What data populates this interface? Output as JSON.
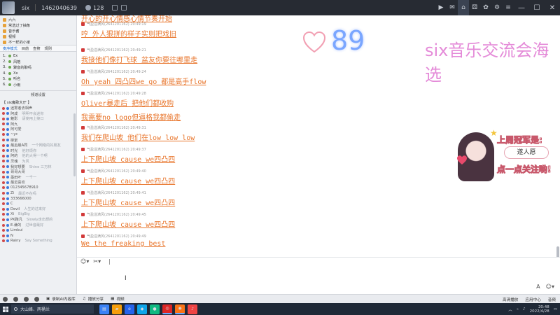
{
  "titlebar": {
    "username": "six",
    "user_id": "1462040639",
    "user_count": "128",
    "icons": [
      "video-icon",
      "message-icon",
      "home-icon",
      "game-icon",
      "gift-icon",
      "settings-icon",
      "menu-icon",
      "minimize-icon",
      "maximize-icon",
      "close-icon"
    ]
  },
  "sidebar": {
    "top_items": [
      "六六",
      "常选过了抽象",
      "音乐酱",
      "视频",
      "不一样的小家",
      "更多"
    ],
    "tabs": [
      "麦序模式",
      "目前",
      "查搜",
      "规则"
    ],
    "list_items": [
      {
        "rank": "1.",
        "label": "Ex"
      },
      {
        "rank": "2.",
        "label": "风格"
      },
      {
        "rank": "3.",
        "label": "聚音的聊吗"
      },
      {
        "rank": "4.",
        "label": "Xx"
      },
      {
        "rank": "5.",
        "label": "听名"
      },
      {
        "rank": "6.",
        "label": "小雨"
      },
      {
        "rank": "7.",
        "label": "歌手"
      }
    ],
    "channel_label": "频道设置",
    "channel_room": "【 six魔歌大厅 】",
    "members": [
      {
        "name": "迷雾者去相声",
        "sub": ""
      },
      {
        "name": "阿成",
        "sub": "明明不会迷你"
      },
      {
        "name": "魅影",
        "sub": "请使用上接口"
      },
      {
        "name": "阿九",
        "sub": ""
      },
      {
        "name": "阿可爱",
        "sub": ""
      },
      {
        "name": "~yc",
        "sub": ""
      },
      {
        "name": "柳絮",
        "sub": ""
      },
      {
        "name": "最后晨A同",
        "sub": "一个网络的好朋友"
      },
      {
        "name": "时光",
        "sub": "他好烦你"
      },
      {
        "name": "阿的",
        "sub": "他的大得一个啊"
      },
      {
        "name": "灵魂",
        "sub": "为风"
      },
      {
        "name": "我好想要",
        "sub": "Shine  三万林"
      },
      {
        "name": "哥哥大哥",
        "sub": ""
      },
      {
        "name": "墨田叶",
        "sub": "一千一"
      },
      {
        "name": "最近喜欢",
        "sub": ""
      },
      {
        "name": "",
        "sub": ""
      },
      {
        "name": "012345678910",
        "sub": ""
      },
      {
        "name": "Zi",
        "sub": "最近不在吗"
      },
      {
        "name": "333666000",
        "sub": ""
      },
      {
        "name": "C",
        "sub": ""
      },
      {
        "name": "Devil",
        "sub": "人生的过来好"
      },
      {
        "name": "Xi",
        "sub": "BigBig"
      },
      {
        "name": "PK跑凡",
        "sub": "Slowly走出想的"
      },
      {
        "name": "E.谦的",
        "sub": "过世音最好"
      },
      {
        "name": "Limbui",
        "sub": ""
      },
      {
        "name": "N",
        "sub": ""
      },
      {
        "name": "Rainy",
        "sub": "Say Something"
      }
    ]
  },
  "overlay": {
    "title": "six音乐交流会海选",
    "counter": "89"
  },
  "sticker": {
    "line1": "上周冠军是:",
    "name": "遂人愿",
    "line2": "点一点关注哟!"
  },
  "chat": {
    "messages": [
      {
        "meta": "气盈溢满风(2641201162)  20:49:19",
        "text": "哼 外人狠拼的样子实则把戏旧"
      },
      {
        "meta": "气盈溢满风(2641201162)  20:49:21",
        "text": "我接他们像打飞球 盆友你要往哪里走"
      },
      {
        "meta": "气盈溢满风(2641201162)  20:49:24",
        "text": "Oh yeah 四凸四we go 都是高手flow"
      },
      {
        "meta": "气盈溢满风(2641201162)  20:49:28",
        "text": "Oliver暴走后 把他们都收购"
      },
      {
        "meta": "",
        "text": "我需要no logo但逼格我都偷走"
      },
      {
        "meta": "气盈溢满风(2641201162)  20:49:31",
        "text": "我们在爬山坡 他们在low low low"
      },
      {
        "meta": "气盈溢满风(2641201162)  20:49:37",
        "text": "上下爬山坡 cause we四凸四"
      },
      {
        "meta": "气盈溢满风(2641201162)  20:49:40",
        "text": "上下爬山坡 cause we四凸四"
      },
      {
        "meta": "气盈溢满风(2641201162)  20:49:41",
        "text": "上下爬山坡 cause we四凸四"
      },
      {
        "meta": "气盈溢满风(2641201162)  20:49:45",
        "text": "上下爬山坡 cause we四凸四"
      },
      {
        "meta": "气盈溢满风(2641201162)  20:49:49",
        "text": "We the freaking best"
      }
    ],
    "top_cutoff": "开心的开心情感心情节奏开始"
  },
  "input": {
    "emoji_label": "☺▾",
    "scissors_label": "✂▾",
    "send_font": "A",
    "send_more": "☺▾"
  },
  "statusbar": {
    "mic": "",
    "recording": "录制AI内容库",
    "share": "播放分享",
    "effect": "视频",
    "right_quality": "高清播放",
    "right_menu": "应用中心",
    "right_mode": "音频 ",
    "right_more": ""
  },
  "taskbar": {
    "search_placeholder": "大山峰、两桶兰",
    "time": "20:48",
    "date": "2022/4/28"
  },
  "colors": {
    "chat_text": "#e8762d",
    "overlay_title": "#e48ad8",
    "counter": "#7aa6ff",
    "titlebar": "#272b33",
    "taskbar": "#1f2937"
  }
}
